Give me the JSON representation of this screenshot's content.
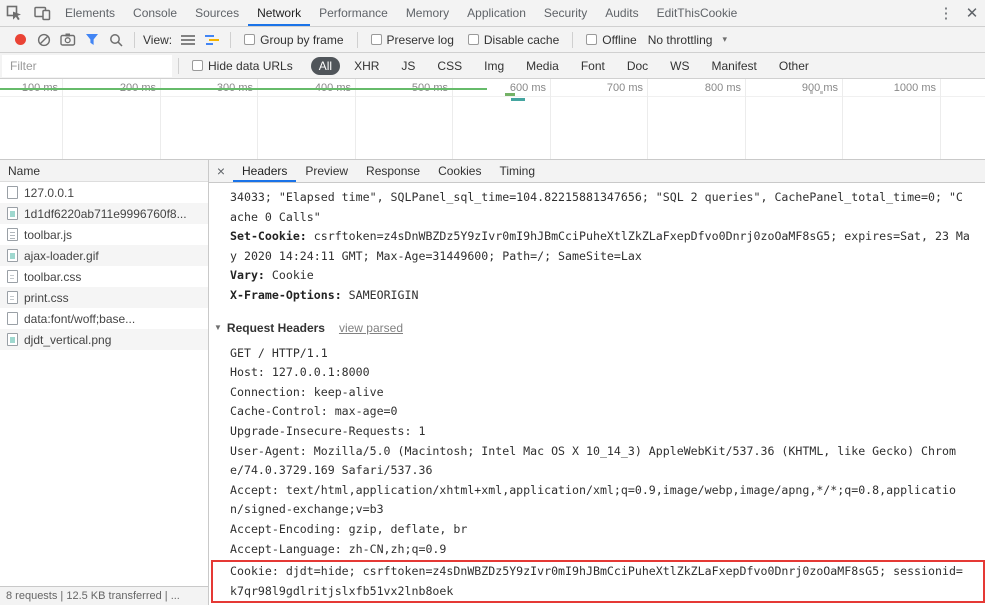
{
  "colors": {
    "accent_blue": "#1a73e8",
    "record_red": "#ea4335",
    "highlight_red": "#e53935",
    "overview_green": "#66bb6a"
  },
  "icons": {
    "more": "⋮",
    "close": "✕",
    "panel_close": "×",
    "caret": "▾",
    "disclosure": "▼"
  },
  "devtools_tabs": {
    "items": [
      "Elements",
      "Console",
      "Sources",
      "Network",
      "Performance",
      "Memory",
      "Application",
      "Security",
      "Audits",
      "EditThisCookie"
    ],
    "active": "Network"
  },
  "toolbar": {
    "view_label": "View:",
    "group_by_frame": "Group by frame",
    "preserve_log": "Preserve log",
    "disable_cache": "Disable cache",
    "offline": "Offline",
    "throttling": "No throttling"
  },
  "filter": {
    "placeholder": "Filter",
    "hide_data_urls": "Hide data URLs",
    "types": [
      "All",
      "XHR",
      "JS",
      "CSS",
      "Img",
      "Media",
      "Font",
      "Doc",
      "WS",
      "Manifest",
      "Other"
    ],
    "active_type": "All"
  },
  "timeline": {
    "ticks": [
      "100 ms",
      "200 ms",
      "300 ms",
      "400 ms",
      "500 ms",
      "600 ms",
      "700 ms",
      "800 ms",
      "900 ms",
      "1000 ms"
    ]
  },
  "requests": {
    "column_header": "Name",
    "rows": [
      {
        "name": "127.0.0.1",
        "icon": "document-icon"
      },
      {
        "name": "1d1df6220ab711e9996760f8...",
        "icon": "image-icon"
      },
      {
        "name": "toolbar.js",
        "icon": "script-icon"
      },
      {
        "name": "ajax-loader.gif",
        "icon": "image-icon"
      },
      {
        "name": "toolbar.css",
        "icon": "stylesheet-icon"
      },
      {
        "name": "print.css",
        "icon": "stylesheet-icon"
      },
      {
        "name": "data:font/woff;base...",
        "icon": "font-icon"
      },
      {
        "name": "djdt_vertical.png",
        "icon": "image-icon"
      }
    ],
    "summary": "8 requests | 12.5 KB transferred | ..."
  },
  "details": {
    "tabs": [
      "Headers",
      "Preview",
      "Response",
      "Cookies",
      "Timing"
    ],
    "active_tab": "Headers",
    "response_lines": [
      {
        "text": "34033; \"Elapsed time\", SQLPanel_sql_time=104.82215881347656; \"SQL 2 queries\", CachePanel_total_time=0; \"C"
      },
      {
        "text": "ache 0 Calls\""
      },
      {
        "name": "Set-Cookie:",
        "text": " csrftoken=z4sDnWBZDz5Y9zIvr0mI9hJBmCciPuheXtlZkZLaFxepDfvo0Dnrj0zoOaMF8sG5; expires=Sat, 23 Ma"
      },
      {
        "text": "y 2020 14:24:11 GMT; Max-Age=31449600; Path=/; SameSite=Lax"
      },
      {
        "name": "Vary:",
        "text": " Cookie"
      },
      {
        "name": "X-Frame-Options:",
        "text": " SAMEORIGIN"
      }
    ],
    "request_headers_title": "Request Headers",
    "view_parsed_label": "view parsed",
    "request_lines": [
      "GET / HTTP/1.1",
      "Host: 127.0.0.1:8000",
      "Connection: keep-alive",
      "Cache-Control: max-age=0",
      "Upgrade-Insecure-Requests: 1",
      "User-Agent: Mozilla/5.0 (Macintosh; Intel Mac OS X 10_14_3) AppleWebKit/537.36 (KHTML, like Gecko) Chrom",
      "e/74.0.3729.169 Safari/537.36",
      "Accept: text/html,application/xhtml+xml,application/xml;q=0.9,image/webp,image/apng,*/*;q=0.8,applicatio",
      "n/signed-exchange;v=b3",
      "Accept-Encoding: gzip, deflate, br",
      "Accept-Language: zh-CN,zh;q=0.9"
    ],
    "cookie_lines": [
      "Cookie: djdt=hide; csrftoken=z4sDnWBZDz5Y9zIvr0mI9hJBmCciPuheXtlZkZLaFxepDfvo0Dnrj0zoOaMF8sG5; sessionid=",
      "k7qr98l9gdlritjslxfb51vx2lnb8oek"
    ]
  }
}
